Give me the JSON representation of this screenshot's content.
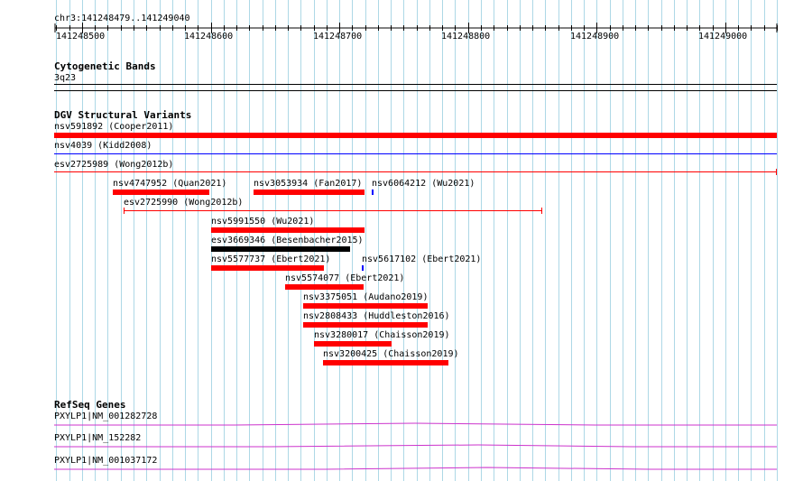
{
  "ruler": {
    "range_label": "chr3:141248479..141249040",
    "start": 141248479,
    "end": 141249040,
    "ticks": [
      "141248500",
      "141248600",
      "141248700",
      "141248800",
      "141248900",
      "141249000"
    ]
  },
  "colors": {
    "grid": "#add8e6",
    "variant_loss": "#ff0000",
    "variant_gain": "#0000ff",
    "variant_other": "#000000",
    "gene": "#cc33cc"
  },
  "cytoband": {
    "title": "Cytogenetic Bands",
    "band": "3q23"
  },
  "dgv": {
    "title": "DGV Structural Variants",
    "items": [
      {
        "label": "nsv591892 (Cooper2011)",
        "color": "red",
        "style": "bar"
      },
      {
        "label": "nsv4039 (Kidd2008)",
        "color": "blue",
        "style": "line"
      },
      {
        "label": "esv2725989 (Wong2012b)",
        "color": "red",
        "style": "line"
      },
      {
        "label": "nsv4747952 (Quan2021)",
        "color": "red",
        "style": "bar"
      },
      {
        "label": "nsv3053934 (Fan2017)",
        "color": "red",
        "style": "bar"
      },
      {
        "label": "nsv6064212 (Wu2021)",
        "color": "blue",
        "style": "tick"
      },
      {
        "label": "esv2725990 (Wong2012b)",
        "color": "red",
        "style": "interval"
      },
      {
        "label": "nsv5991550 (Wu2021)",
        "color": "red",
        "style": "bar"
      },
      {
        "label": "esv3669346 (Besenbacher2015)",
        "color": "black",
        "style": "bar"
      },
      {
        "label": "nsv5577737 (Ebert2021)",
        "color": "red",
        "style": "bar"
      },
      {
        "label": "nsv5617102 (Ebert2021)",
        "color": "blue",
        "style": "tick"
      },
      {
        "label": "nsv5574077 (Ebert2021)",
        "color": "red",
        "style": "bar"
      },
      {
        "label": "nsv3375051 (Audano2019)",
        "color": "red",
        "style": "bar"
      },
      {
        "label": "nsv2808433 (Huddleston2016)",
        "color": "red",
        "style": "bar"
      },
      {
        "label": "nsv3280017 (Chaisson2019)",
        "color": "red",
        "style": "bar"
      },
      {
        "label": "nsv3200425 (Chaisson2019)",
        "color": "red",
        "style": "bar"
      }
    ]
  },
  "refseq": {
    "title": "RefSeq Genes",
    "genes": [
      {
        "label": "PXYLP1|NM_001282728"
      },
      {
        "label": "PXYLP1|NM_152282"
      },
      {
        "label": "PXYLP1|NM_001037172"
      }
    ]
  }
}
